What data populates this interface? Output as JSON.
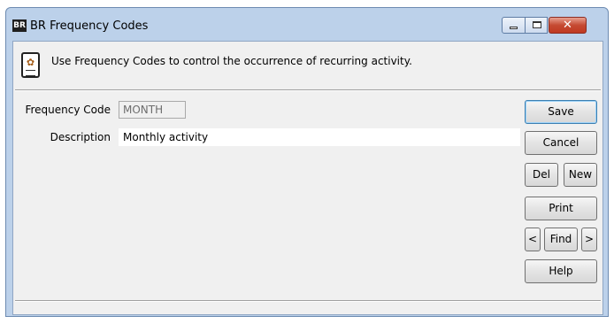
{
  "window": {
    "app_icon": "BR",
    "title": "BR Frequency Codes",
    "controls": {
      "minimize": "minimize-icon",
      "maximize": "maximize-icon",
      "close": "✕"
    }
  },
  "info": {
    "icon": "document-gear-icon",
    "text": "Use Frequency Codes to control the occurrence of recurring activity."
  },
  "form": {
    "frequency_code": {
      "label": "Frequency Code",
      "value": "MONTH"
    },
    "description": {
      "label": "Description",
      "value": "Monthly activity"
    }
  },
  "buttons": {
    "save": "Save",
    "cancel": "Cancel",
    "del": "Del",
    "new": "New",
    "print": "Print",
    "prev": "<",
    "find": "Find",
    "next": ">",
    "help": "Help"
  },
  "colors": {
    "frame": "#bcd1ea",
    "client": "#f0f0f0",
    "close_button": "#c54a32",
    "default_button_border": "#3c7fb1"
  }
}
